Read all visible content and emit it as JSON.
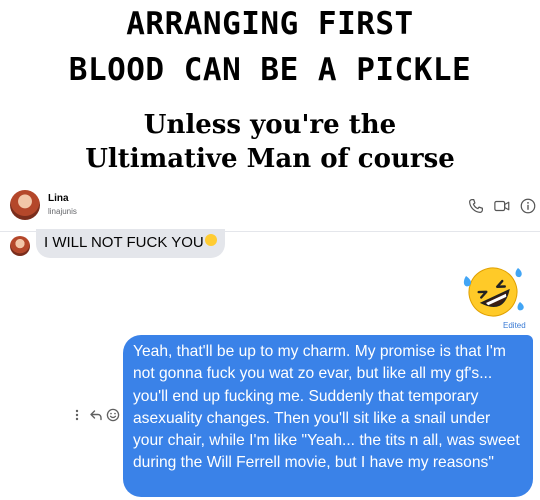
{
  "meme": {
    "title_line1": "ARRANGING FIRST",
    "title_line2": "BLOOD CAN BE A PICKLE",
    "subtitle_line1": "Unless you're the",
    "subtitle_line2": "Ultimative Man of course"
  },
  "chat_header": {
    "contact_name": "Lina",
    "contact_handle": "linajunis",
    "icons": [
      "phone-icon",
      "video-icon",
      "info-icon"
    ]
  },
  "messages": {
    "incoming": {
      "text": "I WILL NOT FUCK YOU",
      "emoji": "grinning-sweat-emoji"
    },
    "sticker": "rolling-on-floor-laughing-emoji",
    "outgoing": {
      "edited_label": "Edited",
      "text": "Yeah, that'll be up to my charm. My promise is that I'm not gonna fuck you wat zo evar, but like all my gf's... you'll end up fucking me. Suddenly that temporary asexuality changes. Then you'll sit like a snail under your chair, while I'm like \"Yeah... the tits n all, was sweet during the Will Ferrell movie, but I have my reasons\""
    },
    "action_icons": [
      "more-icon",
      "reply-icon",
      "react-icon"
    ]
  },
  "colors": {
    "outgoing_bubble": "#3a82e8",
    "incoming_bubble": "#e4e6eb",
    "edited_label": "#3a7bd5"
  }
}
